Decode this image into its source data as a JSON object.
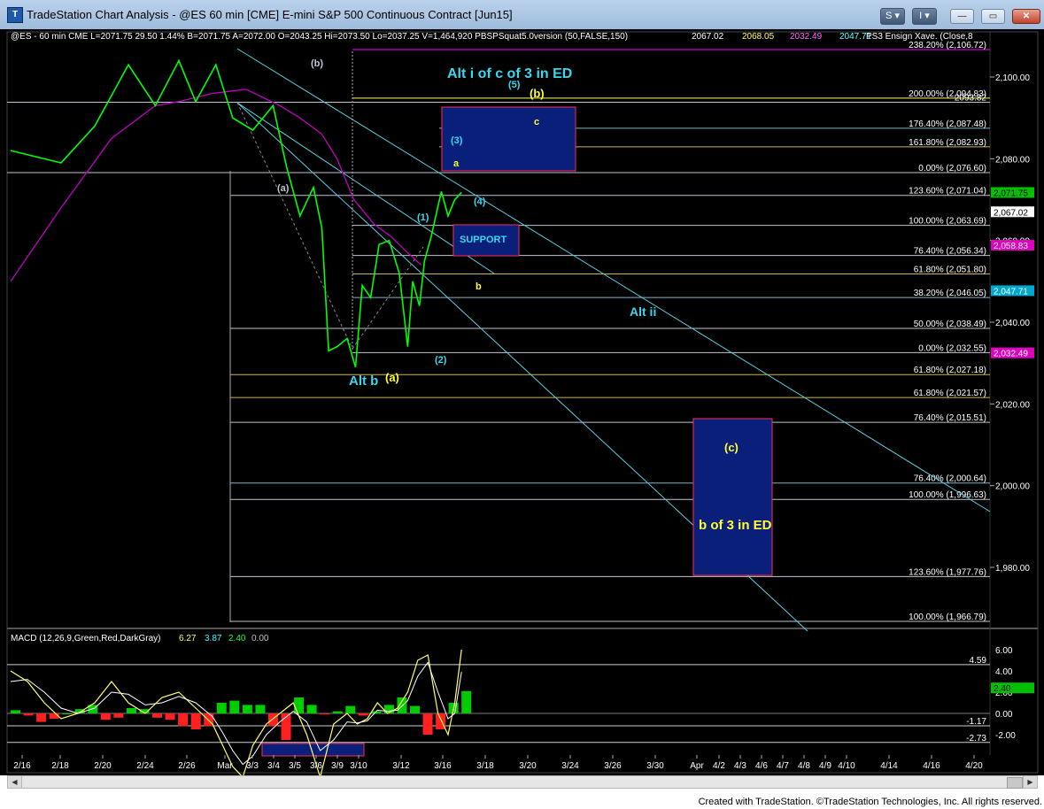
{
  "window": {
    "title": "TradeStation Chart Analysis - @ES 60 min [CME] E-mini S&P 500 Continuous Contract [Jun15]",
    "app_icon": "tradestation-icon",
    "btn_s": "S ▾",
    "btn_i": "I ▾",
    "min_label": "—",
    "max_label": "▭",
    "close_label": "✕"
  },
  "colors": {
    "background": "#000000",
    "price": "#00ff00",
    "moving_average": "#c000c0",
    "fib_line": "#bfc4d0",
    "channel": "#5ad0e0",
    "box_fill": "#0a1f7a",
    "box_border": "#ff2b5a",
    "label_cyan": "#38d8f0",
    "label_yellow": "#ffff33",
    "macd_hist_pos": "#00cc00",
    "macd_hist_neg": "#ff2020"
  },
  "header": {
    "symbol_line": "@ES - 60 min  CME  L=2071.75  29.50  1.44%  B=2071.75  A=2072.00  O=2043.25  Hi=2073.50  Lo=2037.25  V=1,464,920  PBSPSquat5.0version (50,FALSE,150)",
    "pbsp_values": [
      "2067.02",
      "2068.05",
      "2032.49",
      "2047.71"
    ],
    "ensign_label": "PS3 Ensign Xave. (Close,8"
  },
  "chart_data": {
    "type": "line",
    "title": "@ES 60 min [CME] E-mini S&P 500 Continuous Contract [Jun15]",
    "x_tick_labels": [
      "2/16",
      "2/18",
      "2/20",
      "2/24",
      "2/26",
      "Mar",
      "3/3",
      "3/4",
      "3/5",
      "3/6",
      "3/9",
      "3/10",
      "3/12",
      "3/16",
      "3/18",
      "3/20",
      "3/24",
      "3/26",
      "3/30",
      "Apr",
      "4/2",
      "4/3",
      "4/6",
      "4/7",
      "4/8",
      "4/9",
      "4/10",
      "4/14",
      "4/16",
      "4/20"
    ],
    "y_axis_labels": [
      "2,100.00",
      "2,080.00",
      "2,060.00",
      "2,040.00",
      "2,020.00",
      "2,000.00",
      "1,980.00"
    ],
    "ylim": [
      1964,
      2110
    ],
    "price_path": {
      "x": [
        0,
        1.5,
        2.5,
        3.5,
        4.3,
        5,
        5.5,
        6.1,
        6.6,
        7.2,
        7.8,
        8.2,
        8.6,
        9.0,
        9.25,
        9.45,
        9.7,
        10.0,
        10.25,
        10.45,
        10.7,
        10.95,
        11.25,
        11.55,
        11.8,
        11.95,
        12.15,
        12.3,
        12.5,
        12.8,
        13.0,
        13.2,
        13.4
      ],
      "y": [
        2082,
        2079,
        2088,
        2103,
        2093,
        2104,
        2094,
        2103,
        2090,
        2087,
        2093,
        2078,
        2066,
        2073,
        2063,
        2033,
        2034,
        2036,
        2029,
        2049,
        2046,
        2059,
        2060,
        2052,
        2034,
        2050,
        2044,
        2055,
        2061,
        2072,
        2066,
        2070,
        2071.75
      ]
    },
    "ma_path": {
      "x": [
        0,
        1.5,
        3,
        4.3,
        5,
        6,
        7,
        8,
        8.6,
        9.25,
        9.7,
        10.2,
        10.8,
        11.3,
        11.8,
        12.2
      ],
      "y": [
        2050,
        2068,
        2085,
        2093,
        2094,
        2096,
        2097,
        2093,
        2090,
        2086,
        2080,
        2070,
        2064,
        2061,
        2057,
        2054
      ]
    },
    "fib_levels": [
      {
        "label": "238.20% (2,106.72)",
        "value": 2106.72,
        "color": "#ff00ff"
      },
      {
        "label": "200.00% (2,094.83)",
        "value": 2094.83,
        "color": "#ffff66"
      },
      {
        "label": "2093.82",
        "value": 2093.82,
        "color": "#bfc4d0"
      },
      {
        "label": "176.40% (2,087.48)",
        "value": 2087.48,
        "color": "#7fb2c8"
      },
      {
        "label": "161.80% (2,082.93)",
        "value": 2082.93,
        "color": "#c8b45a"
      },
      {
        "label": "0.00% (2,076.60)",
        "value": 2076.6,
        "color": "#bfc4d0"
      },
      {
        "label": "123.60% (2,071.04)",
        "value": 2071.04,
        "color": "#bfc4d0"
      },
      {
        "label": "100.00% (2,063.69)",
        "value": 2063.69,
        "color": "#bfc4d0"
      },
      {
        "label": "76.40% (2,056.34)",
        "value": 2056.34,
        "color": "#bfc4d0"
      },
      {
        "label": "61.80% (2,051.80)",
        "value": 2051.8,
        "color": "#c8b45a"
      },
      {
        "label": "38.20% (2,046.05)",
        "value": 2046.05,
        "color": "#7fb2c8"
      },
      {
        "label": "50.00% (2,038.49)",
        "value": 2038.49,
        "color": "#bfc4d0"
      },
      {
        "label": "0.00% (2,032.55)",
        "value": 2032.55,
        "color": "#bfc4d0"
      },
      {
        "label": "61.80% (2,027.18)",
        "value": 2027.18,
        "color": "#c8b45a"
      },
      {
        "label": "61.80% (2,021.57)",
        "value": 2021.57,
        "color": "#c8b45a"
      },
      {
        "label": "76.40% (2,015.51)",
        "value": 2015.51,
        "color": "#bfc4d0"
      },
      {
        "label": "76.40% (2,000.64)",
        "value": 2000.64,
        "color": "#7fb2c8"
      },
      {
        "label": "100.00% (1,996.63)",
        "value": 1996.63,
        "color": "#bfc4d0"
      },
      {
        "label": "123.60% (1,977.76)",
        "value": 1977.76,
        "color": "#bfc4d0"
      },
      {
        "label": "100.00% (1,966.79)",
        "value": 1966.79,
        "color": "#bfc4d0"
      }
    ],
    "price_tags": [
      {
        "label": "2,071.75",
        "value": 2071.75,
        "bg": "#00c000",
        "fg": "#000000"
      },
      {
        "label": "2,067.02",
        "value": 2067.02,
        "bg": "#ffffff",
        "fg": "#000000"
      },
      {
        "label": "2,058.83",
        "value": 2058.83,
        "bg": "#e000c0",
        "fg": "#ffffff"
      },
      {
        "label": "2,047.71",
        "value": 2047.71,
        "bg": "#00a8d0",
        "fg": "#ffffff"
      },
      {
        "label": "2,032.49",
        "value": 2032.49,
        "bg": "#e000c0",
        "fg": "#ffffff"
      }
    ],
    "annotations": [
      {
        "text": "Alt i of c of 3 in ED",
        "color": "#38d8f0",
        "size": 16
      },
      {
        "text": "(b)",
        "color": "#ffff33",
        "size": 13
      },
      {
        "text": "(5)",
        "color": "#38d8f0",
        "size": 11
      },
      {
        "text": "(3)",
        "color": "#38d8f0",
        "size": 11
      },
      {
        "text": "c",
        "color": "#ffff33",
        "size": 11
      },
      {
        "text": "a",
        "color": "#ffff33",
        "size": 11
      },
      {
        "text": "(4)",
        "color": "#38d8f0",
        "size": 11
      },
      {
        "text": "(1)",
        "color": "#38d8f0",
        "size": 11
      },
      {
        "text": "SUPPORT",
        "color": "#38d8f0",
        "size": 11
      },
      {
        "text": "b",
        "color": "#ffff33",
        "size": 11
      },
      {
        "text": "Alt ii",
        "color": "#38d8f0",
        "size": 14
      },
      {
        "text": "(2)",
        "color": "#38d8f0",
        "size": 11
      },
      {
        "text": "Alt b",
        "color": "#38d8f0",
        "size": 15
      },
      {
        "text": "(a)",
        "color": "#ffff33",
        "size": 13
      },
      {
        "text": "(b)",
        "color": "#bfc4d0",
        "size": 11
      },
      {
        "text": "(a)",
        "color": "#bfc4d0",
        "size": 11
      },
      {
        "text": "(c)",
        "color": "#ffff33",
        "size": 13
      },
      {
        "text": "b of 3 in ED",
        "color": "#ffff33",
        "size": 15
      }
    ],
    "macd": {
      "label": "MACD (12,26,9,Green,Red,DarkGray)",
      "values": [
        "6.27",
        "3.87",
        "2.40",
        "0.00"
      ],
      "value_colors": [
        "#ffff66",
        "#33ffff",
        "#22ff22",
        "#c0c0c0"
      ],
      "y_axis_labels": [
        "6.00",
        "4.00",
        "2.00",
        "0.00",
        "-2.00"
      ],
      "level_labels": [
        "4.59",
        "-1.17",
        "-2.73"
      ],
      "tag": "2.40",
      "ylim": [
        -4,
        7
      ],
      "macd_line": {
        "x": [
          0,
          0.5,
          1,
          1.5,
          2,
          2.5,
          3,
          3.5,
          4,
          4.5,
          5,
          5.5,
          6,
          6.3,
          6.6,
          6.9,
          7.2,
          7.6,
          8,
          8.4,
          8.8,
          9.2,
          9.6,
          10,
          10.3,
          10.6,
          10.9,
          11.2,
          11.5,
          11.8,
          12.1,
          12.4,
          12.7,
          13,
          13.2,
          13.4
        ],
        "y": [
          4,
          3,
          1,
          -0.5,
          0,
          1,
          3,
          1,
          0,
          1.5,
          2,
          0.5,
          -1,
          -3,
          -5,
          -6,
          -3,
          -1,
          0,
          1,
          -2,
          -6,
          -1,
          0,
          -1,
          -0.5,
          1,
          0,
          0.5,
          2,
          5,
          5.5,
          0,
          -2,
          1,
          6
        ]
      },
      "signal_line": {
        "x": [
          0,
          0.5,
          1,
          1.5,
          2,
          2.5,
          3,
          3.5,
          4,
          4.5,
          5,
          5.5,
          6,
          6.3,
          6.6,
          6.9,
          7.2,
          7.6,
          8,
          8.4,
          8.8,
          9.2,
          9.6,
          10,
          10.3,
          10.6,
          10.9,
          11.2,
          11.5,
          11.8,
          12.1,
          12.4,
          12.7,
          13,
          13.2,
          13.4
        ],
        "y": [
          3,
          3.2,
          2,
          0.5,
          0,
          0.5,
          2,
          1.8,
          0.8,
          1,
          1.6,
          1,
          -0.3,
          -1.8,
          -3.5,
          -4.8,
          -4,
          -2,
          -0.8,
          0.2,
          -0.8,
          -3.5,
          -2.5,
          -0.8,
          -0.9,
          -0.7,
          0.3,
          0.2,
          0.3,
          1.2,
          3.5,
          4.8,
          2,
          -0.5,
          0,
          3.9
        ]
      },
      "histogram": [
        0.3,
        -0.2,
        -0.8,
        -0.5,
        0,
        0.4,
        0.8,
        -0.6,
        -0.4,
        0.5,
        0.4,
        -0.4,
        -0.6,
        -1.2,
        -1.5,
        -1.2,
        1,
        1.2,
        0.8,
        0.8,
        -1.2,
        -2.5,
        1.5,
        0.8,
        -0.1,
        0.2,
        0.7,
        -0.2,
        0.2,
        0.8,
        1.5,
        0.7,
        -2,
        -1.5,
        1,
        2.1
      ]
    },
    "grid": false,
    "legend": "none"
  },
  "footer": "Created with TradeStation. ©TradeStation Technologies, Inc. All rights reserved."
}
